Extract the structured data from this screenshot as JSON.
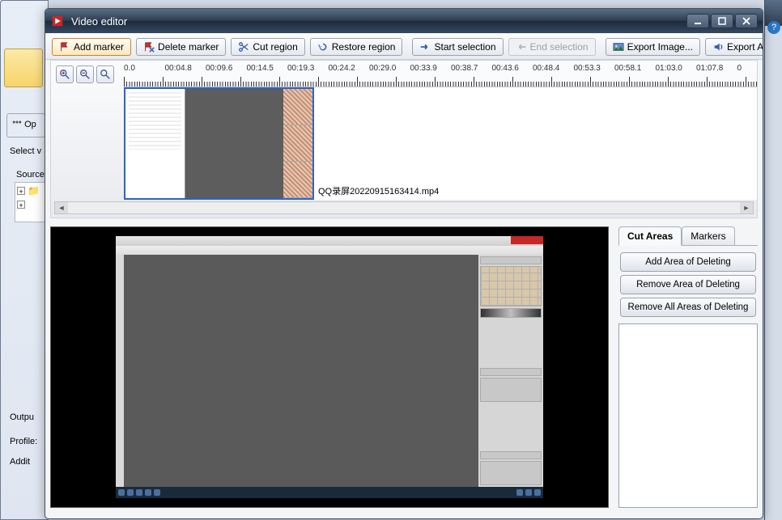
{
  "bg": {
    "options_label": "Op",
    "select_label": "Select v",
    "source_label": "Source",
    "output_label": "Outpu",
    "profile_label": "Profile:",
    "addit_label": "Addit"
  },
  "window": {
    "title": "Video editor"
  },
  "toolbar": {
    "add_marker": "Add marker",
    "delete_marker": "Delete marker",
    "cut_region": "Cut region",
    "restore_region": "Restore region",
    "start_selection": "Start selection",
    "end_selection": "End selection",
    "export_image": "Export Image...",
    "export_audio": "Export Audio..."
  },
  "ruler": {
    "labels": [
      "0.0",
      "00:04.8",
      "00:09.6",
      "00:14.5",
      "00:19.3",
      "00:24.2",
      "00:29.0",
      "00:33.9",
      "00:38.7",
      "00:43.6",
      "00:48.4",
      "00:53.3",
      "00:58.1",
      "01:03.0",
      "01:07.8",
      "0"
    ]
  },
  "clip": {
    "filename": "QQ录屏20220915163414.mp4"
  },
  "sidepanel": {
    "tabs": {
      "cut_areas": "Cut Areas",
      "markers": "Markers"
    },
    "add_area": "Add Area of Deleting",
    "remove_area": "Remove Area of Deleting",
    "remove_all": "Remove All Areas of Deleting"
  }
}
